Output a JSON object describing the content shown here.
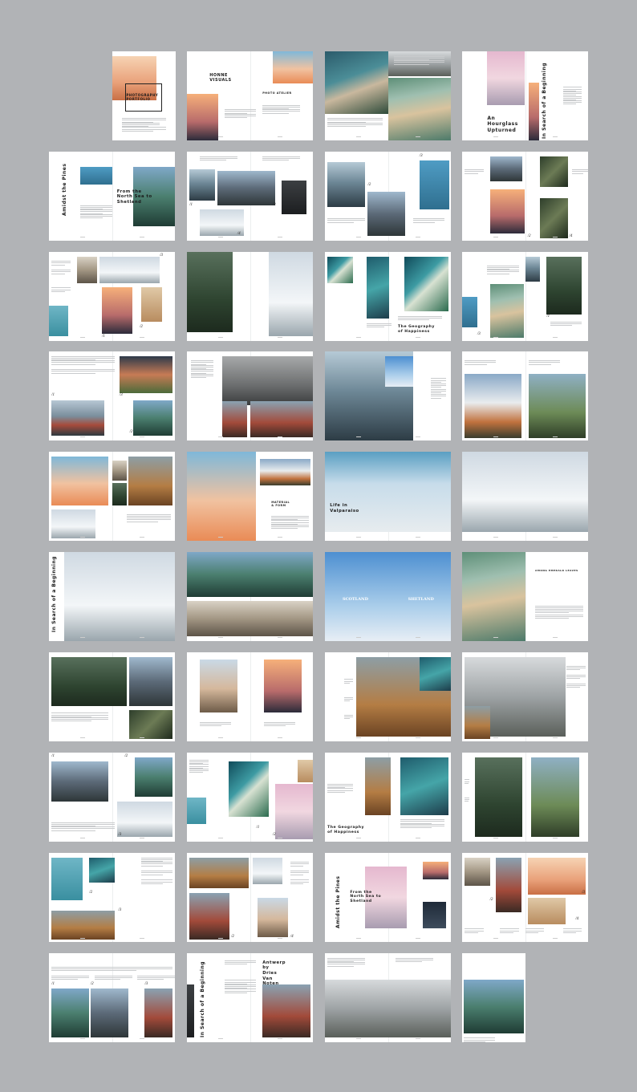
{
  "background_color": "#b1b3b6",
  "text": {
    "portfolio": "PHOTOGRAPHY\nPORTFOLIO",
    "honne": "HONNE\nVISUALS",
    "atelier": "PHOTO ATELIER",
    "hourglass": "An\nHourglass\nUpturned",
    "beginning": "In Search of a Beginning",
    "north_sea": "From the\nNorth Sea to\nShetland",
    "amidst_pines": "Amidst the Pines",
    "geography": "The Geography\nof Happiness",
    "material": "MATERIAL\n& FORM",
    "valparaiso": "Life in\nValparaiso",
    "scotland": "SCOTLAND",
    "shetland": "SHETLAND",
    "emerald": "AMONG EMERALD LEAVES",
    "antwerp": "Antwerp\nby\nDries\nVan\nNoten",
    "n1": "/1",
    "n2": "/2",
    "n3": "/3",
    "n4": "/4"
  }
}
